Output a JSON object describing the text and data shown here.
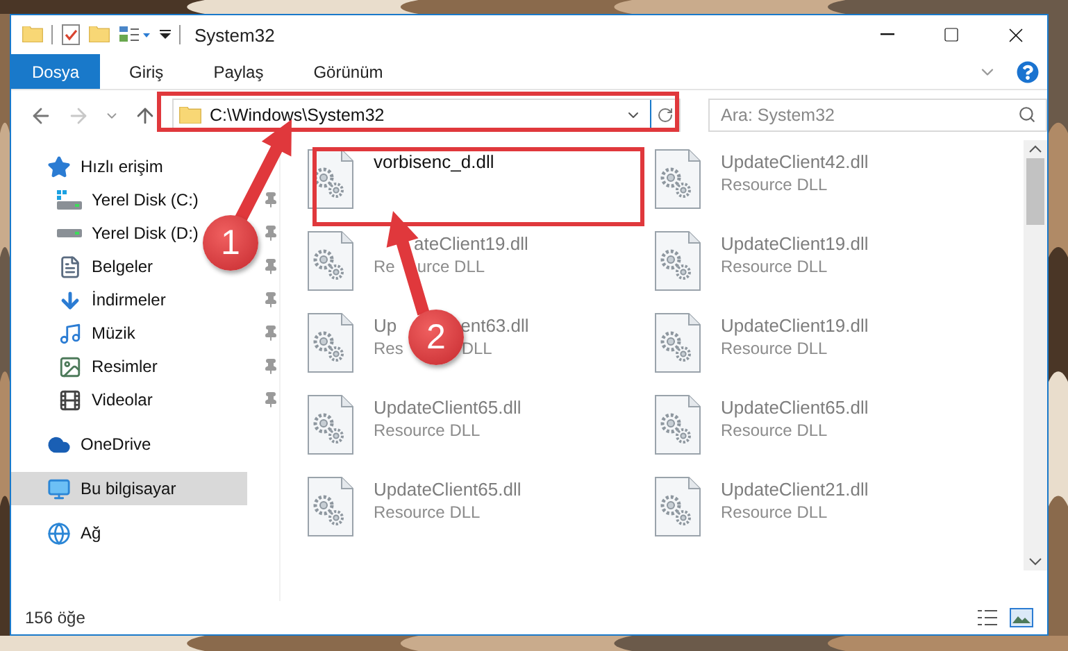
{
  "window": {
    "title": "System32"
  },
  "ribbon_tabs": [
    {
      "label": "Dosya",
      "selected": true
    },
    {
      "label": "Giriş",
      "selected": false
    },
    {
      "label": "Paylaş",
      "selected": false
    },
    {
      "label": "Görünüm",
      "selected": false
    }
  ],
  "address": {
    "path": "C:\\Windows\\System32"
  },
  "search": {
    "placeholder": "Ara: System32"
  },
  "sidebar": {
    "items": [
      {
        "label": "Hızlı erişim",
        "kind": "quick",
        "selected": false,
        "children": [
          {
            "label": "Yerel Disk (C:)",
            "kind": "system-drive",
            "pinned": true
          },
          {
            "label": "Yerel Disk (D:)",
            "kind": "drive",
            "pinned": true
          },
          {
            "label": "Belgeler",
            "kind": "documents",
            "pinned": true
          },
          {
            "label": "İndirmeler",
            "kind": "downloads",
            "pinned": true
          },
          {
            "label": "Müzik",
            "kind": "music",
            "pinned": true
          },
          {
            "label": "Resimler",
            "kind": "pictures",
            "pinned": true
          },
          {
            "label": "Videolar",
            "kind": "videos",
            "pinned": true
          }
        ]
      },
      {
        "label": "OneDrive",
        "kind": "cloud",
        "selected": false
      },
      {
        "label": "Bu bilgisayar",
        "kind": "computer",
        "selected": true
      },
      {
        "label": "Ağ",
        "kind": "network",
        "selected": false
      }
    ]
  },
  "files": [
    {
      "name_parts": [
        "vorbisenc_d.dll"
      ],
      "faded": false
    },
    {
      "name_parts": [
        "UpdateClient42.dll"
      ],
      "type_parts": [
        "Resource DLL"
      ],
      "faded": true
    },
    {
      "name_parts": [
        "ateClient19.dll"
      ],
      "type_parts": [
        "Re",
        "urce DLL"
      ],
      "faded": true
    },
    {
      "name_parts": [
        "UpdateClient19.dll"
      ],
      "type_parts": [
        "Resource DLL"
      ],
      "faded": true
    },
    {
      "name_parts": [
        "Up",
        "ent63.dll"
      ],
      "type_parts": [
        "Res",
        "DLL"
      ],
      "faded": true
    },
    {
      "name_parts": [
        "UpdateClient19.dll"
      ],
      "type_parts": [
        "Resource DLL"
      ],
      "faded": true
    },
    {
      "name_parts": [
        "UpdateClient65.dll"
      ],
      "type_parts": [
        "Resource DLL"
      ],
      "faded": true
    },
    {
      "name_parts": [
        "UpdateClient65.dll"
      ],
      "type_parts": [
        "Resource DLL"
      ],
      "faded": true
    },
    {
      "name_parts": [
        "UpdateClient65.dll"
      ],
      "type_parts": [
        "Resource DLL"
      ],
      "faded": true
    },
    {
      "name_parts": [
        "UpdateClient21.dll"
      ],
      "type_parts": [
        "Resource DLL"
      ],
      "faded": true
    }
  ],
  "status_bar": {
    "count": "156 öğe"
  },
  "annotations": [
    {
      "label": "1"
    },
    {
      "label": "2"
    }
  ]
}
